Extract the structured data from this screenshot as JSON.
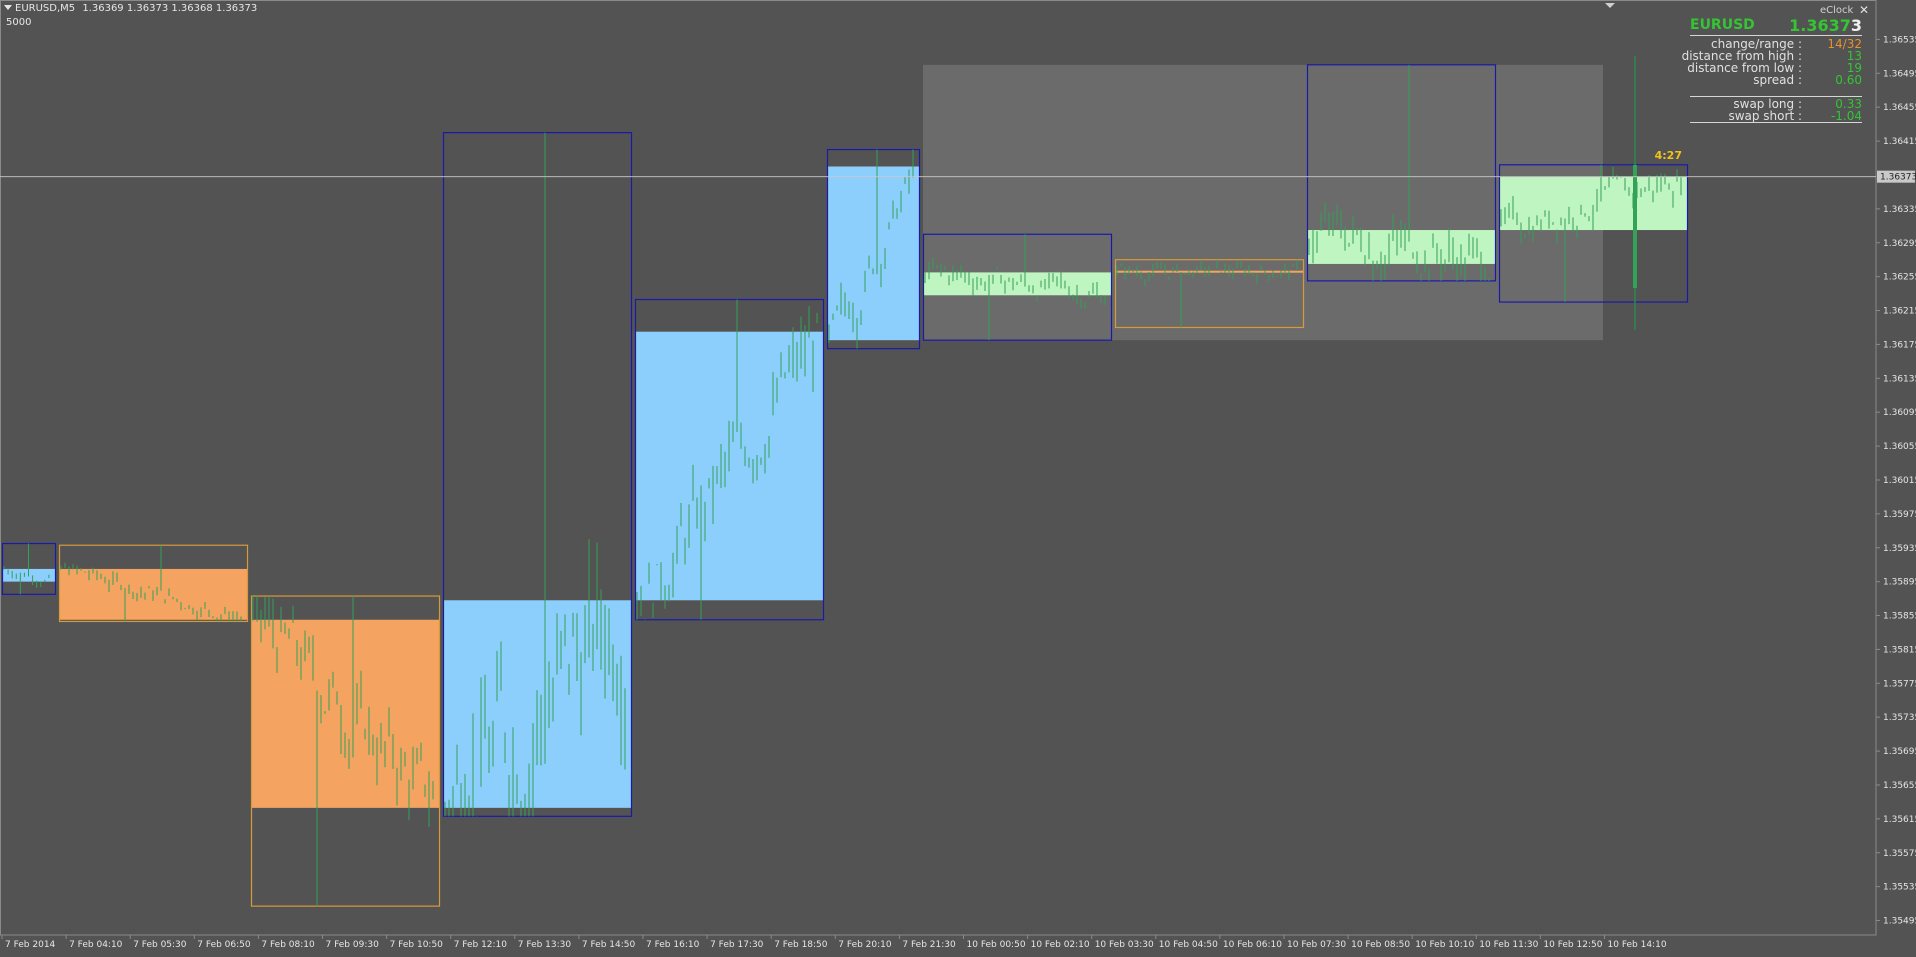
{
  "header": {
    "collapse_icon": "triangle-down-icon",
    "symbol": "EURUSD,M5",
    "ohlc": "1.36369 1.36373 1.36368 1.36373",
    "sub": "5000"
  },
  "eclock": {
    "title": "eClock",
    "close_icon": "close-icon",
    "symbol": "EURUSD",
    "price_main": "1.3637",
    "price_last": "3",
    "rows": [
      {
        "label": "change/range :",
        "value": "14/32",
        "color": "#e8912e"
      },
      {
        "label": "distance from high :",
        "value": "13",
        "color": "#34c434"
      },
      {
        "label": "distance from low :",
        "value": "19",
        "color": "#34c434"
      },
      {
        "label": "spread :",
        "value": "0.60",
        "color": "#34c434"
      },
      {
        "label": "swap long :",
        "value": "0.33",
        "color": "#34c434"
      },
      {
        "label": "swap short :",
        "value": "-1.04",
        "color": "#34c434"
      }
    ],
    "countdown": "4:27"
  },
  "colors": {
    "background": "#535353",
    "bull_fill": "#8ccffc",
    "bear_fill": "#f4a460",
    "neutral_fill": "#bff5c0",
    "bull_border": "#1a1aa8",
    "bear_border": "#d79a3a",
    "candles": "#33a057",
    "highlight": "#6b6b6b",
    "price_line": "#c9c9c9",
    "text": "#e6e6e6"
  },
  "chart_data": {
    "type": "candlestick",
    "symbol": "EURUSD",
    "timeframe": "M5",
    "current_price": "1.36373",
    "x_tick_labels": [
      "7 Feb 2014",
      "7 Feb 04:10",
      "7 Feb 05:30",
      "7 Feb 06:50",
      "7 Feb 08:10",
      "7 Feb 09:30",
      "7 Feb 10:50",
      "7 Feb 12:10",
      "7 Feb 13:30",
      "7 Feb 14:50",
      "7 Feb 16:10",
      "7 Feb 17:30",
      "7 Feb 18:50",
      "7 Feb 20:10",
      "7 Feb 21:30",
      "10 Feb 00:50",
      "10 Feb 02:10",
      "10 Feb 03:30",
      "10 Feb 04:50",
      "10 Feb 06:10",
      "10 Feb 07:30",
      "10 Feb 08:50",
      "10 Feb 10:10",
      "10 Feb 11:30",
      "10 Feb 12:50",
      "10 Feb 14:10"
    ],
    "y_tick_labels": [
      "1.36535",
      "1.36495",
      "1.36455",
      "1.36415",
      "1.36335",
      "1.36295",
      "1.36255",
      "1.36215",
      "1.36175",
      "1.36135",
      "1.36095",
      "1.36055",
      "1.36015",
      "1.35975",
      "1.35935",
      "1.35895",
      "1.35855",
      "1.35815",
      "1.35775",
      "1.35735",
      "1.35695",
      "1.35655",
      "1.35615",
      "1.35575",
      "1.35535",
      "1.35495"
    ],
    "y_range": [
      1.35485,
      1.36565
    ],
    "hour_boxes": [
      {
        "kind": "bull",
        "open": 1.3591,
        "close": 1.35895,
        "high": 1.3594,
        "low": 1.3588
      },
      {
        "kind": "bear",
        "open": 1.3591,
        "close": 1.3585,
        "high": 1.35938,
        "low": 1.35848
      },
      {
        "kind": "bear",
        "open": 1.3585,
        "close": 1.35628,
        "high": 1.35878,
        "low": 1.35512
      },
      {
        "kind": "bull",
        "open": 1.35628,
        "close": 1.35873,
        "high": 1.36425,
        "low": 1.35618
      },
      {
        "kind": "bull",
        "open": 1.35873,
        "close": 1.3619,
        "high": 1.36228,
        "low": 1.3585
      },
      {
        "kind": "bull",
        "open": 1.3618,
        "close": 1.36385,
        "high": 1.36405,
        "low": 1.3617
      },
      {
        "kind": "neutral",
        "open": 1.3626,
        "close": 1.36233,
        "high": 1.36305,
        "low": 1.3618
      },
      {
        "kind": "bear",
        "open": 1.3626,
        "close": 1.36262,
        "high": 1.36275,
        "low": 1.36195
      },
      {
        "kind": "neutral",
        "open": 1.3631,
        "close": 1.3627,
        "high": 1.36505,
        "low": 1.3625
      },
      {
        "kind": "neutral",
        "open": 1.3631,
        "close": 1.36373,
        "high": 1.36387,
        "low": 1.36225
      }
    ],
    "highlight_range": {
      "high": 1.36505,
      "low": 1.3618
    }
  }
}
